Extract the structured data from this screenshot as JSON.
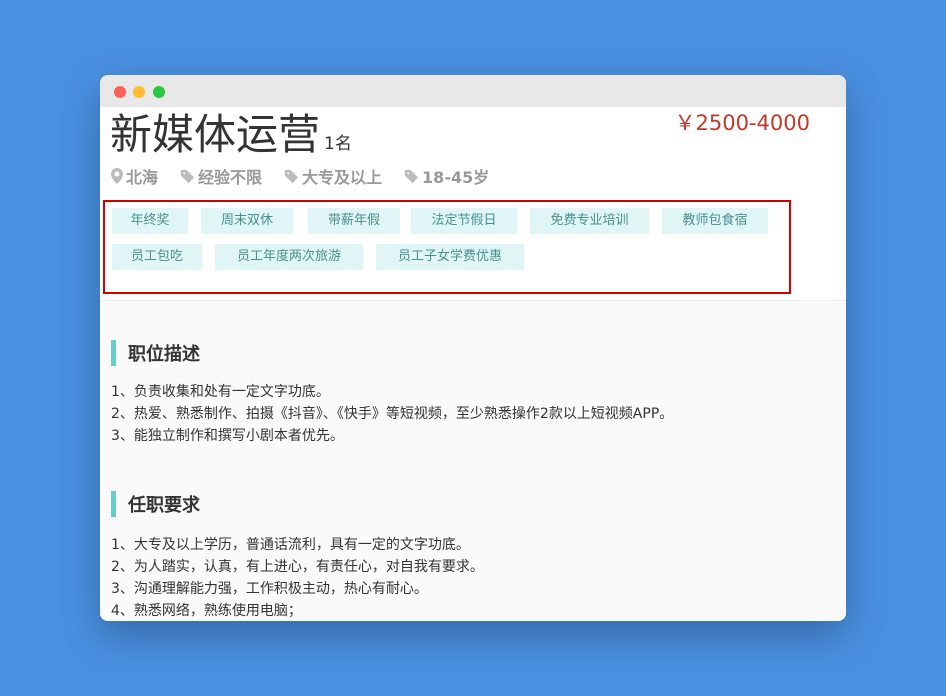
{
  "job": {
    "title": "新媒体运营",
    "headcount": "1名",
    "salary": "￥2500-4000"
  },
  "meta": {
    "location": "北海",
    "experience": "经验不限",
    "education": "大专及以上",
    "age": "18-45岁"
  },
  "benefits": [
    "年终奖",
    "周末双休",
    "带薪年假",
    "法定节假日",
    "免费专业培训",
    "教师包食宿",
    "员工包吃",
    "员工年度两次旅游",
    "员工子女学费优惠"
  ],
  "description": {
    "heading": "职位描述",
    "lines": [
      "1、负责收集和处有一定文字功底。",
      "2、热爱、熟悉制作、拍摄《抖音》、《快手》等短视频，至少熟悉操作2款以上短视频APP。",
      "3、能独立制作和撰写小剧本者优先。"
    ]
  },
  "requirements": {
    "heading": "任职要求",
    "lines": [
      "1、大专及以上学历，普通话流利，具有一定的文字功底。",
      "2、为人踏实，认真，有上进心，有责任心，对自我有要求。",
      "3、沟通理解能力强，工作积极主动，热心有耐心。",
      "4、熟悉网络，熟练使用电脑；"
    ]
  },
  "colors": {
    "salary": "#c0392b",
    "tag_bg": "#e0f5f5",
    "tag_text": "#4a8f8f",
    "accent_bar": "#66cccc",
    "highlight_border": "#d40000"
  }
}
